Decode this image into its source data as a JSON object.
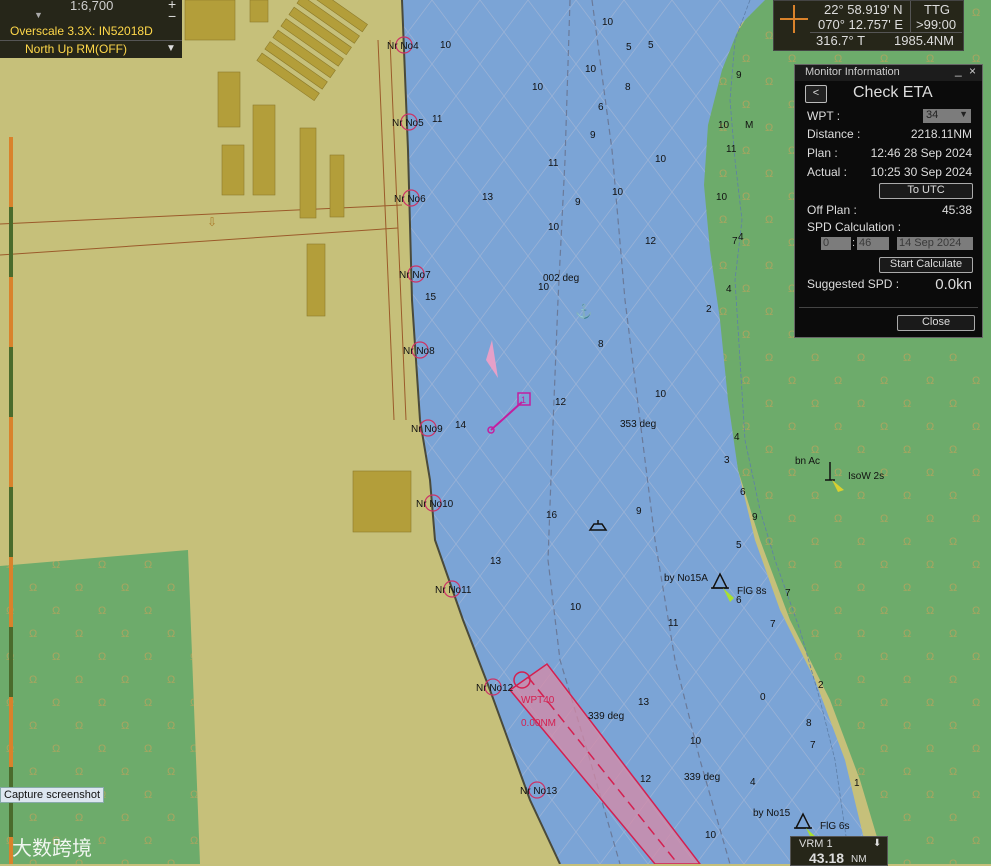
{
  "status": {
    "scale": "1:6,700",
    "overscale": "Overscale 3.3X: IN52018D",
    "orientation": "North  Up RM(OFF)"
  },
  "cursor": {
    "lat": "22° 58.919' N",
    "lon": "070° 12.757' E",
    "bearing": "316.7° T",
    "ttg_label": "TTG",
    "ttg_value": ">99:00",
    "distance": "1985.4NM"
  },
  "monitor": {
    "window_title": "Monitor Information",
    "back_label": "<",
    "title": "Check ETA",
    "wpt_label": "WPT :",
    "wpt_value": "34",
    "distance_label": "Distance :",
    "distance_value": "2218.11NM",
    "plan_label": "Plan :",
    "plan_value": "12:46 28 Sep 2024",
    "actual_label": "Actual :",
    "actual_value": "10:25 30 Sep 2024",
    "to_utc_label": "To UTC",
    "off_plan_label": "Off Plan :",
    "off_plan_value": "45:38",
    "spd_calc_label": "SPD Calculation :",
    "spd_hour": "0",
    "spd_min": "46",
    "spd_date": "14 Sep 2024",
    "start_calc_label": "Start Calculate",
    "suggested_label": "Suggested SPD :",
    "suggested_value": "0.0kn",
    "close_label": "Close"
  },
  "vrm": {
    "label": "VRM 1",
    "value": "43.18",
    "unit": "NM"
  },
  "capture_label": "Capture screenshot",
  "watermark": "大数跨境",
  "chart_labels": {
    "buoys": [
      "Nr No4",
      "Nr No5",
      "Nr No6",
      "Nr No7",
      "Nr No8",
      "Nr No9",
      "Nr No10",
      "Nr No11",
      "Nr No12",
      "Nr No13"
    ],
    "courses": [
      "002 deg",
      "353 deg",
      "339 deg",
      "339 deg"
    ],
    "route_wpt": "WPT40",
    "route_dist": "0.00NM",
    "beacon_1": "by No15A",
    "beacon_1_light": "FlG 8s",
    "beacon_2": "by No15",
    "beacon_2_light": "FlG 6s",
    "light_1": "bn Ac",
    "light_1_char": "IsoW 2s",
    "route_number": "1",
    "m_label": "M",
    "soundings": [
      "10",
      "11",
      "13",
      "15",
      "14",
      "13",
      "16",
      "10",
      "10",
      "10",
      "10",
      "8",
      "9",
      "11",
      "10",
      "9",
      "10",
      "12",
      "10",
      "10",
      "8",
      "12",
      "10",
      "9",
      "11",
      "13",
      "10",
      "12",
      "10",
      "10",
      "9",
      "11",
      "10",
      "7",
      "4",
      "4",
      "6",
      "9",
      "5",
      "6",
      "7",
      "7",
      "0",
      "8",
      "7",
      "4",
      "1",
      "2",
      "5",
      "5",
      "6",
      "3",
      "2",
      "2",
      "4"
    ]
  },
  "colors": {
    "land": "#c6c07a",
    "water": "#7ba4d6",
    "green": "#6dab6b",
    "buoy_ring": "#cc3366",
    "route": "#cc2277"
  }
}
